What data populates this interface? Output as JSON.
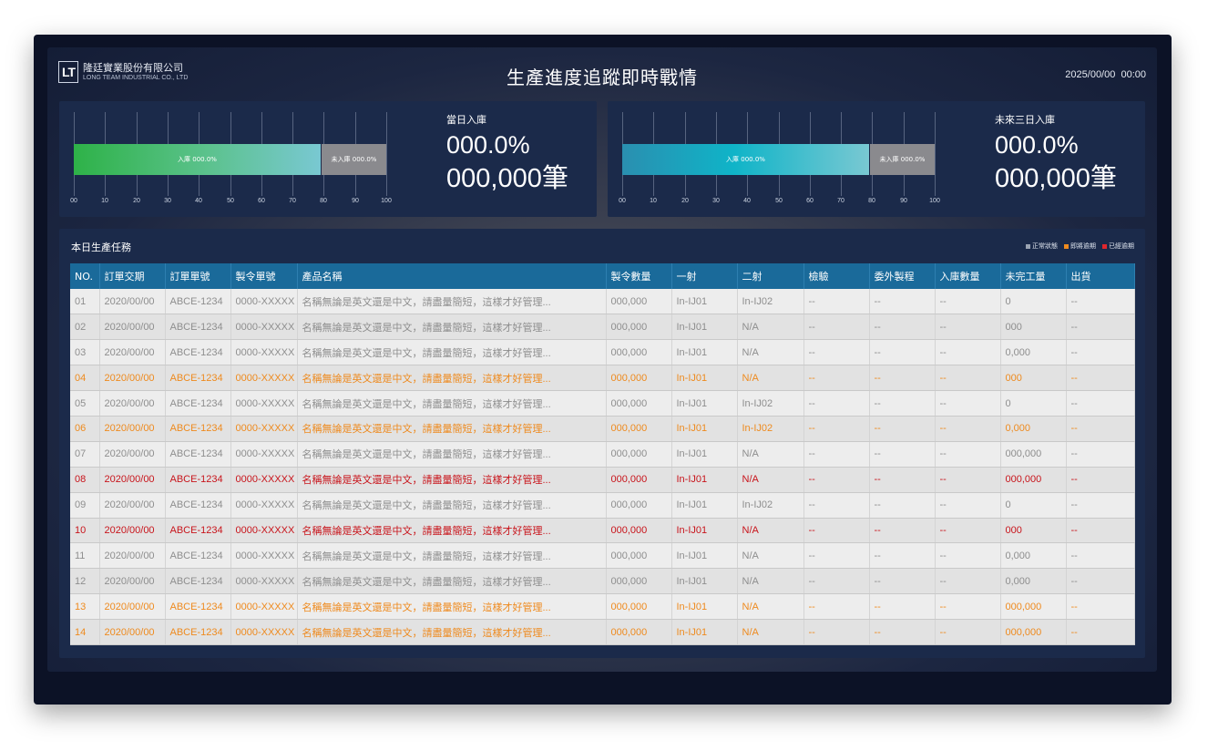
{
  "header": {
    "logo_mark": "LT",
    "company_cn": "隆廷實業股份有限公司",
    "company_en": "LONG TEAM INDUSTRIAL CO., LTD",
    "title": "生產進度追蹤即時戰情",
    "datetime": "2025/00/00  00:00"
  },
  "panels": [
    {
      "label": "當日入庫",
      "done_label": "入庫 000.0%",
      "rest_label": "未入庫 000.0%",
      "progress": 79,
      "percent_text": "000.0%",
      "count_text": "000,000筆"
    },
    {
      "label": "未來三日入庫",
      "done_label": "入庫 000.0%",
      "rest_label": "未入庫 000.0%",
      "progress": 79,
      "percent_text": "000.0%",
      "count_text": "000,000筆"
    }
  ],
  "axis_ticks": [
    "00",
    "10",
    "20",
    "30",
    "40",
    "50",
    "60",
    "70",
    "80",
    "90",
    "100"
  ],
  "tasks": {
    "title": "本日生產任務",
    "legend": [
      {
        "label": "正常狀態",
        "color": "#9aa3b2"
      },
      {
        "label": "即將逾期",
        "color": "#ee8a1e"
      },
      {
        "label": "已經逾期",
        "color": "#e0262d"
      }
    ],
    "columns": [
      "NO.",
      "訂單交期",
      "訂單單號",
      "製令單號",
      "產品名稱",
      "製令數量",
      "一射",
      "二射",
      "檢驗",
      "委外製程",
      "入庫數量",
      "未完工量",
      "出貨"
    ],
    "rows": [
      {
        "status": "normal",
        "cells": [
          "01",
          "2020/00/00",
          "ABCE-1234",
          "0000-XXXXX",
          "名稱無論是英文還是中文，請盡量簡短，這樣才好管理...",
          "000,000",
          "In-IJ01",
          "In-IJ02",
          "--",
          "--",
          "--",
          "0",
          "--"
        ]
      },
      {
        "status": "normal",
        "cells": [
          "02",
          "2020/00/00",
          "ABCE-1234",
          "0000-XXXXX",
          "名稱無論是英文還是中文，請盡量簡短，這樣才好管理...",
          "000,000",
          "In-IJ01",
          "N/A",
          "--",
          "--",
          "--",
          "000",
          "--"
        ]
      },
      {
        "status": "normal",
        "cells": [
          "03",
          "2020/00/00",
          "ABCE-1234",
          "0000-XXXXX",
          "名稱無論是英文還是中文，請盡量簡短，這樣才好管理...",
          "000,000",
          "In-IJ01",
          "N/A",
          "--",
          "--",
          "--",
          "0,000",
          "--"
        ]
      },
      {
        "status": "due",
        "cells": [
          "04",
          "2020/00/00",
          "ABCE-1234",
          "0000-XXXXX",
          "名稱無論是英文還是中文，請盡量簡短，這樣才好管理...",
          "000,000",
          "In-IJ01",
          "N/A",
          "--",
          "--",
          "--",
          "000",
          "--"
        ]
      },
      {
        "status": "normal",
        "cells": [
          "05",
          "2020/00/00",
          "ABCE-1234",
          "0000-XXXXX",
          "名稱無論是英文還是中文，請盡量簡短，這樣才好管理...",
          "000,000",
          "In-IJ01",
          "In-IJ02",
          "--",
          "--",
          "--",
          "0",
          "--"
        ]
      },
      {
        "status": "due",
        "cells": [
          "06",
          "2020/00/00",
          "ABCE-1234",
          "0000-XXXXX",
          "名稱無論是英文還是中文，請盡量簡短，這樣才好管理...",
          "000,000",
          "In-IJ01",
          "In-IJ02",
          "--",
          "--",
          "--",
          "0,000",
          "--"
        ]
      },
      {
        "status": "normal",
        "cells": [
          "07",
          "2020/00/00",
          "ABCE-1234",
          "0000-XXXXX",
          "名稱無論是英文還是中文，請盡量簡短，這樣才好管理...",
          "000,000",
          "In-IJ01",
          "N/A",
          "--",
          "--",
          "--",
          "000,000",
          "--"
        ]
      },
      {
        "status": "overdue",
        "cells": [
          "08",
          "2020/00/00",
          "ABCE-1234",
          "0000-XXXXX",
          "名稱無論是英文還是中文，請盡量簡短，這樣才好管理...",
          "000,000",
          "In-IJ01",
          "N/A",
          "--",
          "--",
          "--",
          "000,000",
          "--"
        ]
      },
      {
        "status": "normal",
        "cells": [
          "09",
          "2020/00/00",
          "ABCE-1234",
          "0000-XXXXX",
          "名稱無論是英文還是中文，請盡量簡短，這樣才好管理...",
          "000,000",
          "In-IJ01",
          "In-IJ02",
          "--",
          "--",
          "--",
          "0",
          "--"
        ]
      },
      {
        "status": "overdue",
        "cells": [
          "10",
          "2020/00/00",
          "ABCE-1234",
          "0000-XXXXX",
          "名稱無論是英文還是中文，請盡量簡短，這樣才好管理...",
          "000,000",
          "In-IJ01",
          "N/A",
          "--",
          "--",
          "--",
          "000",
          "--"
        ]
      },
      {
        "status": "normal",
        "cells": [
          "11",
          "2020/00/00",
          "ABCE-1234",
          "0000-XXXXX",
          "名稱無論是英文還是中文，請盡量簡短，這樣才好管理...",
          "000,000",
          "In-IJ01",
          "N/A",
          "--",
          "--",
          "--",
          "0,000",
          "--"
        ]
      },
      {
        "status": "normal",
        "cells": [
          "12",
          "2020/00/00",
          "ABCE-1234",
          "0000-XXXXX",
          "名稱無論是英文還是中文，請盡量簡短，這樣才好管理...",
          "000,000",
          "In-IJ01",
          "N/A",
          "--",
          "--",
          "--",
          "0,000",
          "--"
        ]
      },
      {
        "status": "due",
        "cells": [
          "13",
          "2020/00/00",
          "ABCE-1234",
          "0000-XXXXX",
          "名稱無論是英文還是中文，請盡量簡短，這樣才好管理...",
          "000,000",
          "In-IJ01",
          "N/A",
          "--",
          "--",
          "--",
          "000,000",
          "--"
        ]
      },
      {
        "status": "due",
        "cells": [
          "14",
          "2020/00/00",
          "ABCE-1234",
          "0000-XXXXX",
          "名稱無論是英文還是中文，請盡量簡短，這樣才好管理...",
          "000,000",
          "In-IJ01",
          "N/A",
          "--",
          "--",
          "--",
          "000,000",
          "--"
        ]
      }
    ]
  }
}
